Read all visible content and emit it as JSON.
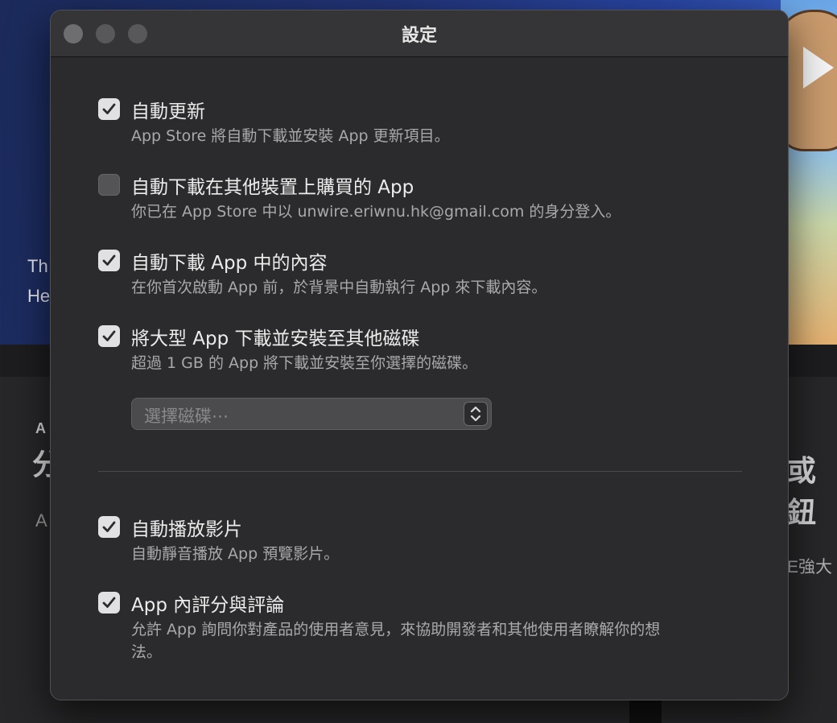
{
  "background": {
    "hero_line1": "Th",
    "hero_line2": "He",
    "side_a1": "A",
    "side_big_left": "分",
    "side_a2": "A",
    "side_big_right": "或鈕",
    "side_small_right": "E強大"
  },
  "dialog": {
    "title": "設定",
    "options": [
      {
        "title": "自動更新",
        "desc": "App Store 將自動下載並安裝 App 更新項目。",
        "checked": true
      },
      {
        "title": "自動下載在其他裝置上購買的 App",
        "desc": "你已在 App Store 中以 unwire.eriwnu.hk@gmail.com 的身分登入。",
        "checked": false
      },
      {
        "title": "自動下載 App 中的內容",
        "desc": "在你首次啟動 App 前，於背景中自動執行 App 來下載內容。",
        "checked": true
      },
      {
        "title": "將大型 App 下載並安裝至其他磁碟",
        "desc": "超過 1 GB 的 App 將下載並安裝至你選擇的磁碟。",
        "checked": true
      },
      {
        "title": "自動播放影片",
        "desc": "自動靜音播放 App 預覽影片。",
        "checked": true
      },
      {
        "title": "App 內評分與評論",
        "desc": "允許 App 詢問你對產品的使用者意見，來協助開發者和其他使用者瞭解你的想法。",
        "checked": true
      }
    ],
    "disk_select": {
      "placeholder": "選擇磁碟⋯"
    }
  },
  "icons": {
    "checkbox": "checkmark-icon",
    "select": "chevron-up-down-icon"
  }
}
